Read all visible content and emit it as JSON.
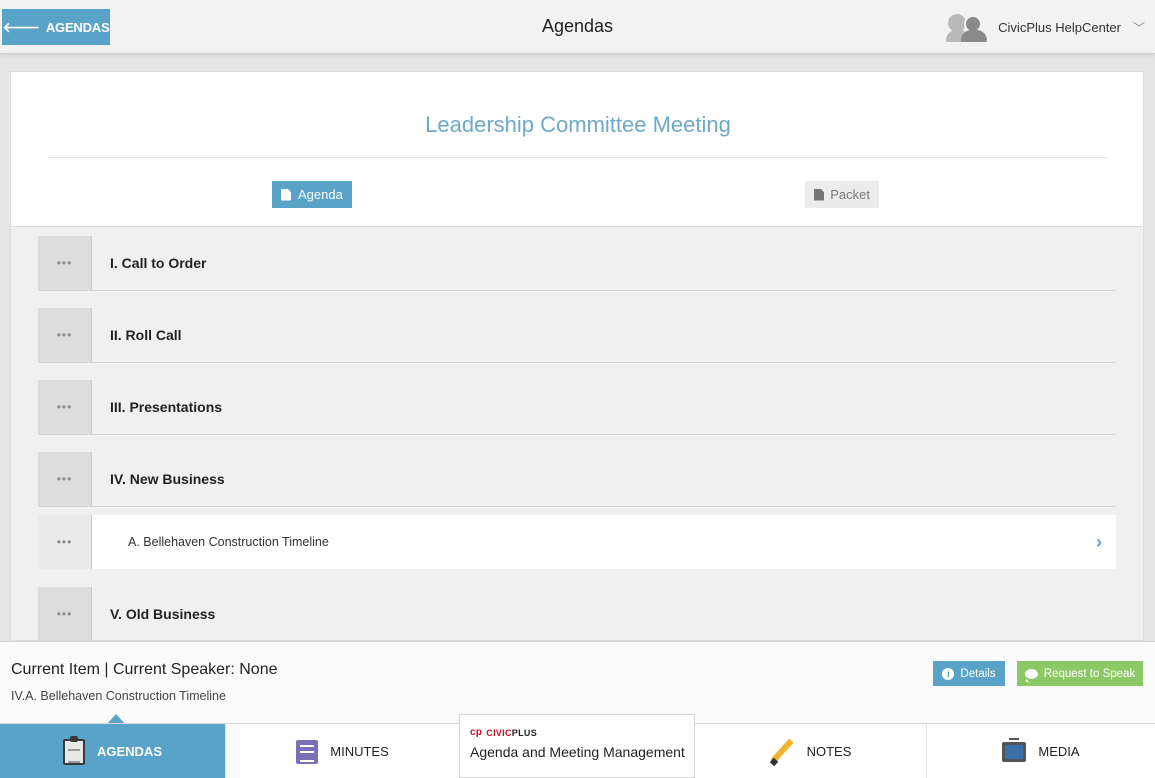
{
  "topbar": {
    "back_label": "AGENDAS",
    "title": "Agendas",
    "user_name": "CivicPlus HelpCenter"
  },
  "meeting": {
    "title": "Leadership Committee Meeting",
    "tabs": [
      {
        "label": "Agenda",
        "active": true
      },
      {
        "label": "Packet",
        "active": false
      }
    ]
  },
  "agenda_items": [
    {
      "label": "I. Call to Order",
      "handle": "•••"
    },
    {
      "label": "II. Roll Call",
      "handle": "•••"
    },
    {
      "label": "III. Presentations",
      "handle": "•••"
    },
    {
      "label": "IV. New Business",
      "handle": "•••"
    },
    {
      "label": "A. Bellehaven Construction Timeline",
      "handle": "•••",
      "sub": true
    },
    {
      "label": "V. Old Business",
      "handle": "•••"
    }
  ],
  "current": {
    "title": "Current Item | Current Speaker: None",
    "item": "IV.A. Bellehaven Construction Timeline",
    "details_label": "Details",
    "speak_label": "Request to Speak"
  },
  "bottom_nav": {
    "agendas": "AGENDAS",
    "minutes": "MINUTES",
    "notes": "NOTES",
    "media": "MEDIA"
  },
  "brand": {
    "logo_cp": "cp",
    "logo_civic": "CIVIC",
    "logo_plus": "PLUS",
    "text": "Agenda and Meeting Management"
  },
  "colors": {
    "accent": "#5aa3c8",
    "speak": "#8cc866",
    "title": "#6ea9c9"
  }
}
